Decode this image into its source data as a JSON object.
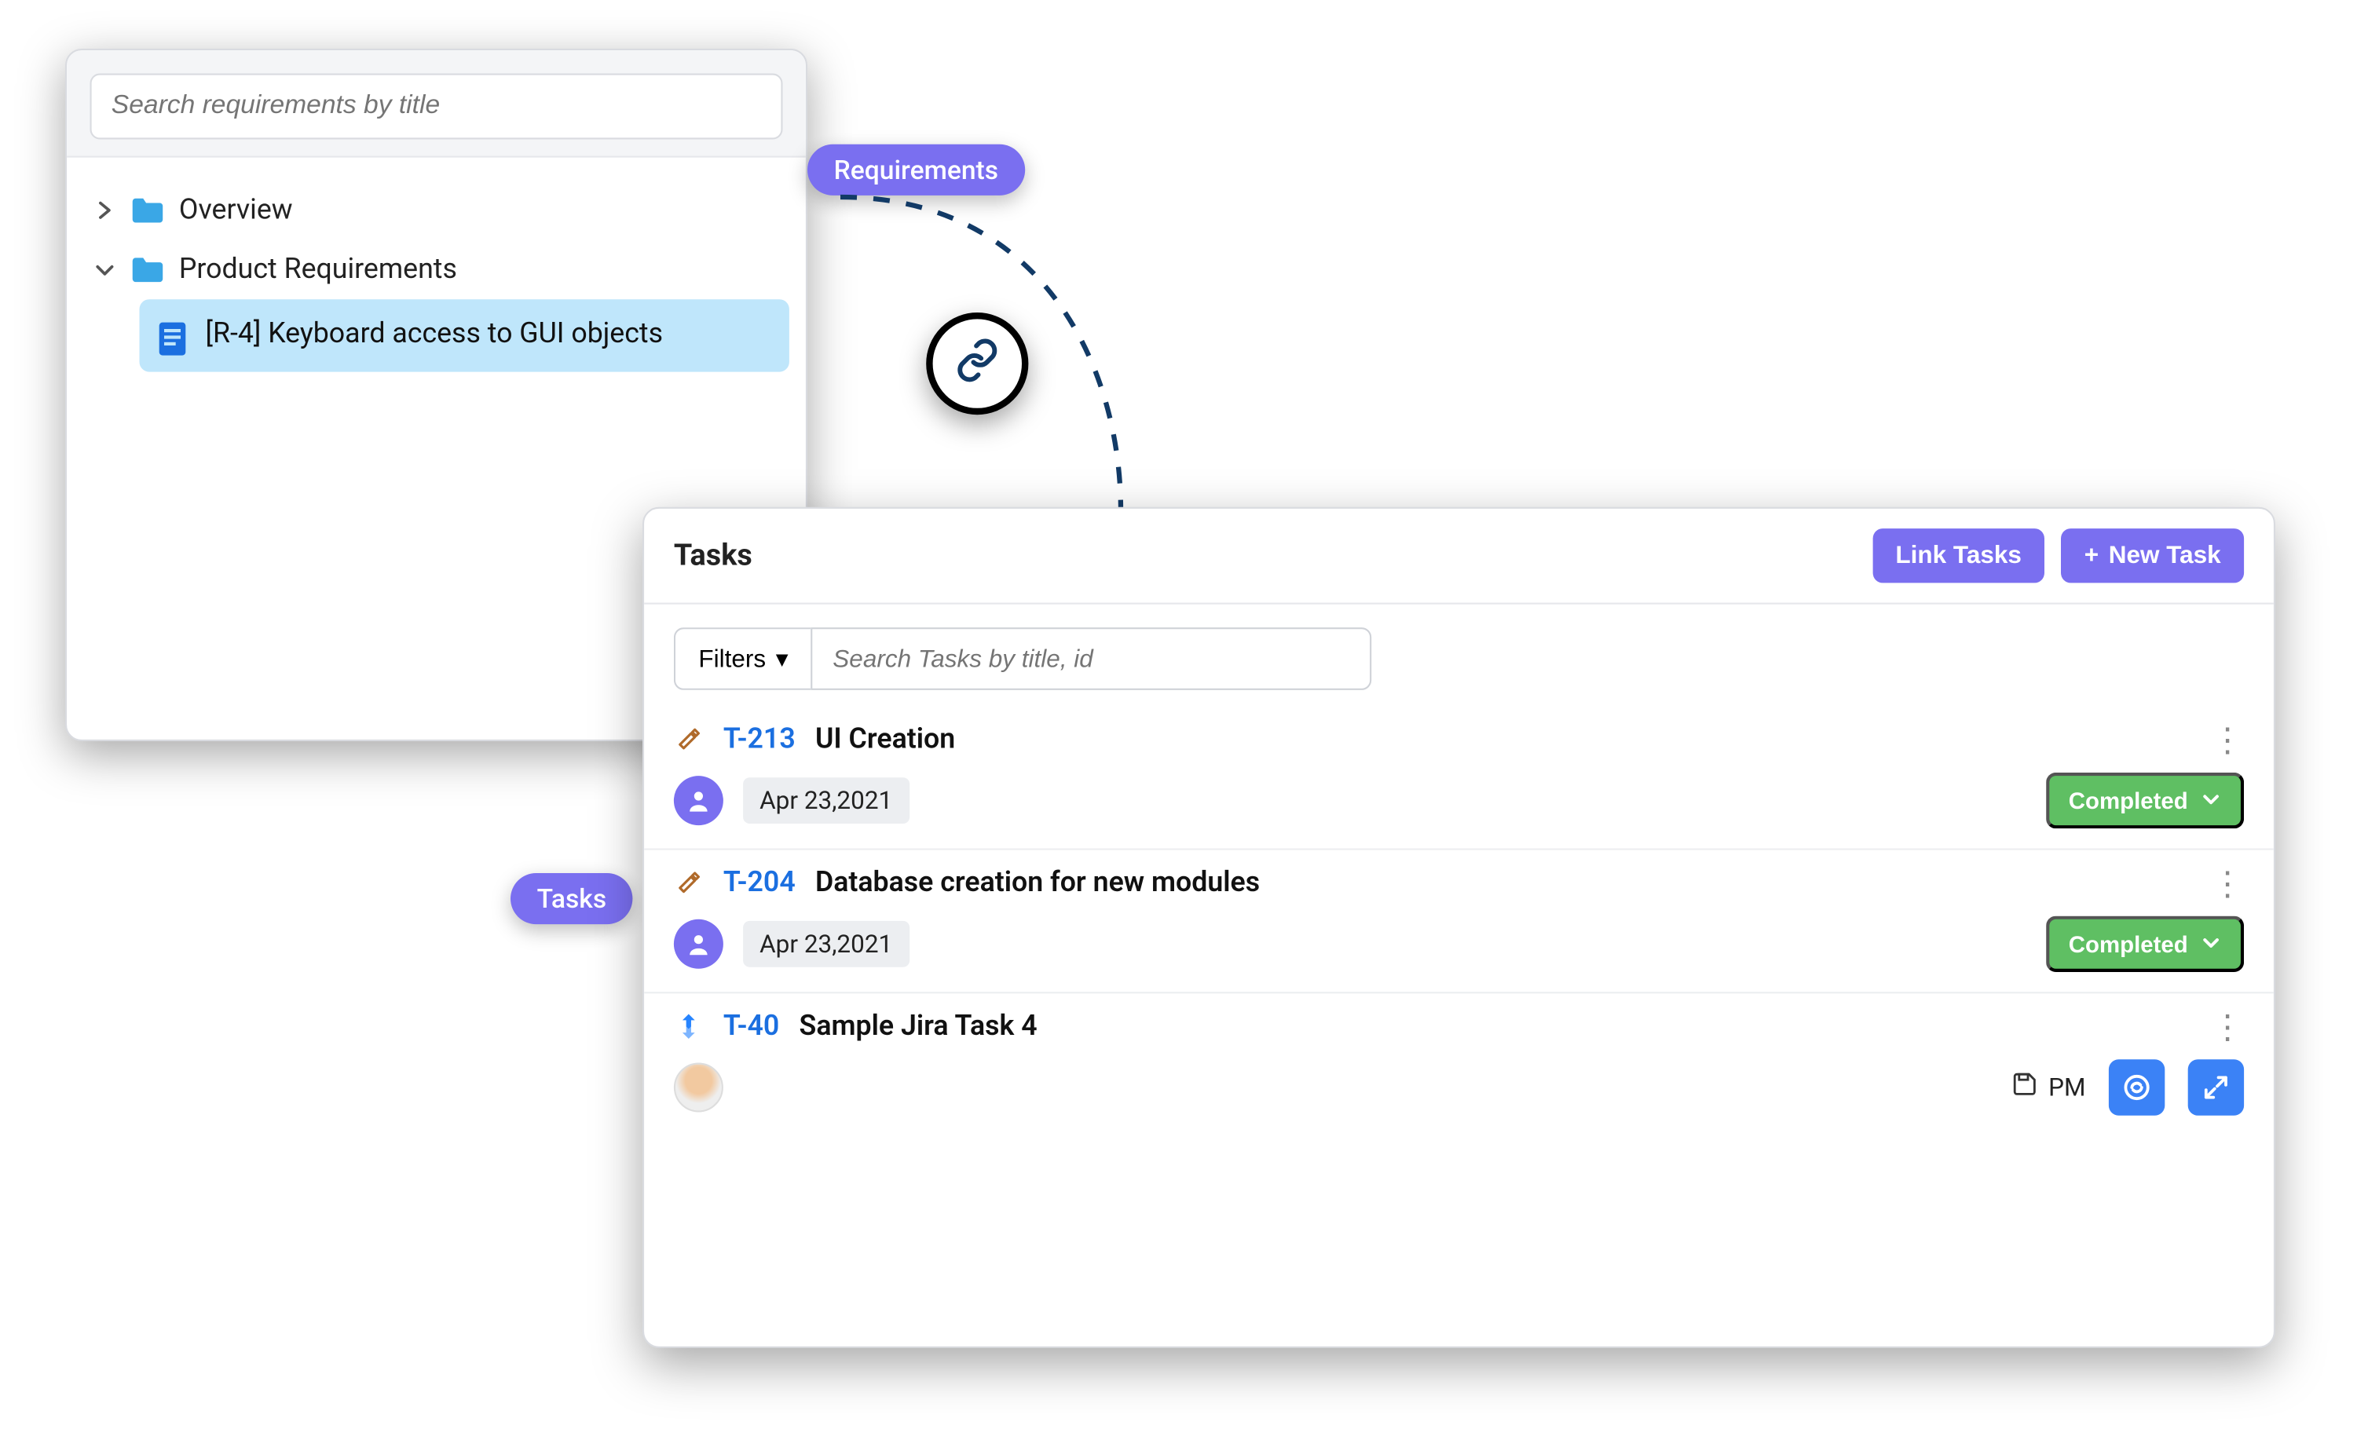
{
  "pills": {
    "requirements": "Requirements",
    "tasks": "Tasks"
  },
  "requirements": {
    "search_placeholder": "Search requirements by title",
    "tree": {
      "overview": "Overview",
      "product_requirements": "Product Requirements",
      "selected_item": "[R-4] Keyboard access to GUI objects"
    }
  },
  "tasks_panel": {
    "title": "Tasks",
    "buttons": {
      "link_tasks": "Link Tasks",
      "new_task": "New Task"
    },
    "filters_label": "Filters",
    "search_placeholder": "Search Tasks by title, id",
    "items": [
      {
        "id": "T-213",
        "title": "UI Creation",
        "date": "Apr 23,2021",
        "status": "Completed",
        "type": "hammer"
      },
      {
        "id": "T-204",
        "title": "Database creation for new modules",
        "date": "Apr 23,2021",
        "status": "Completed",
        "type": "hammer"
      },
      {
        "id": "T-40",
        "title": "Sample Jira Task 4",
        "type": "jira",
        "pm_label": "PM"
      }
    ]
  }
}
